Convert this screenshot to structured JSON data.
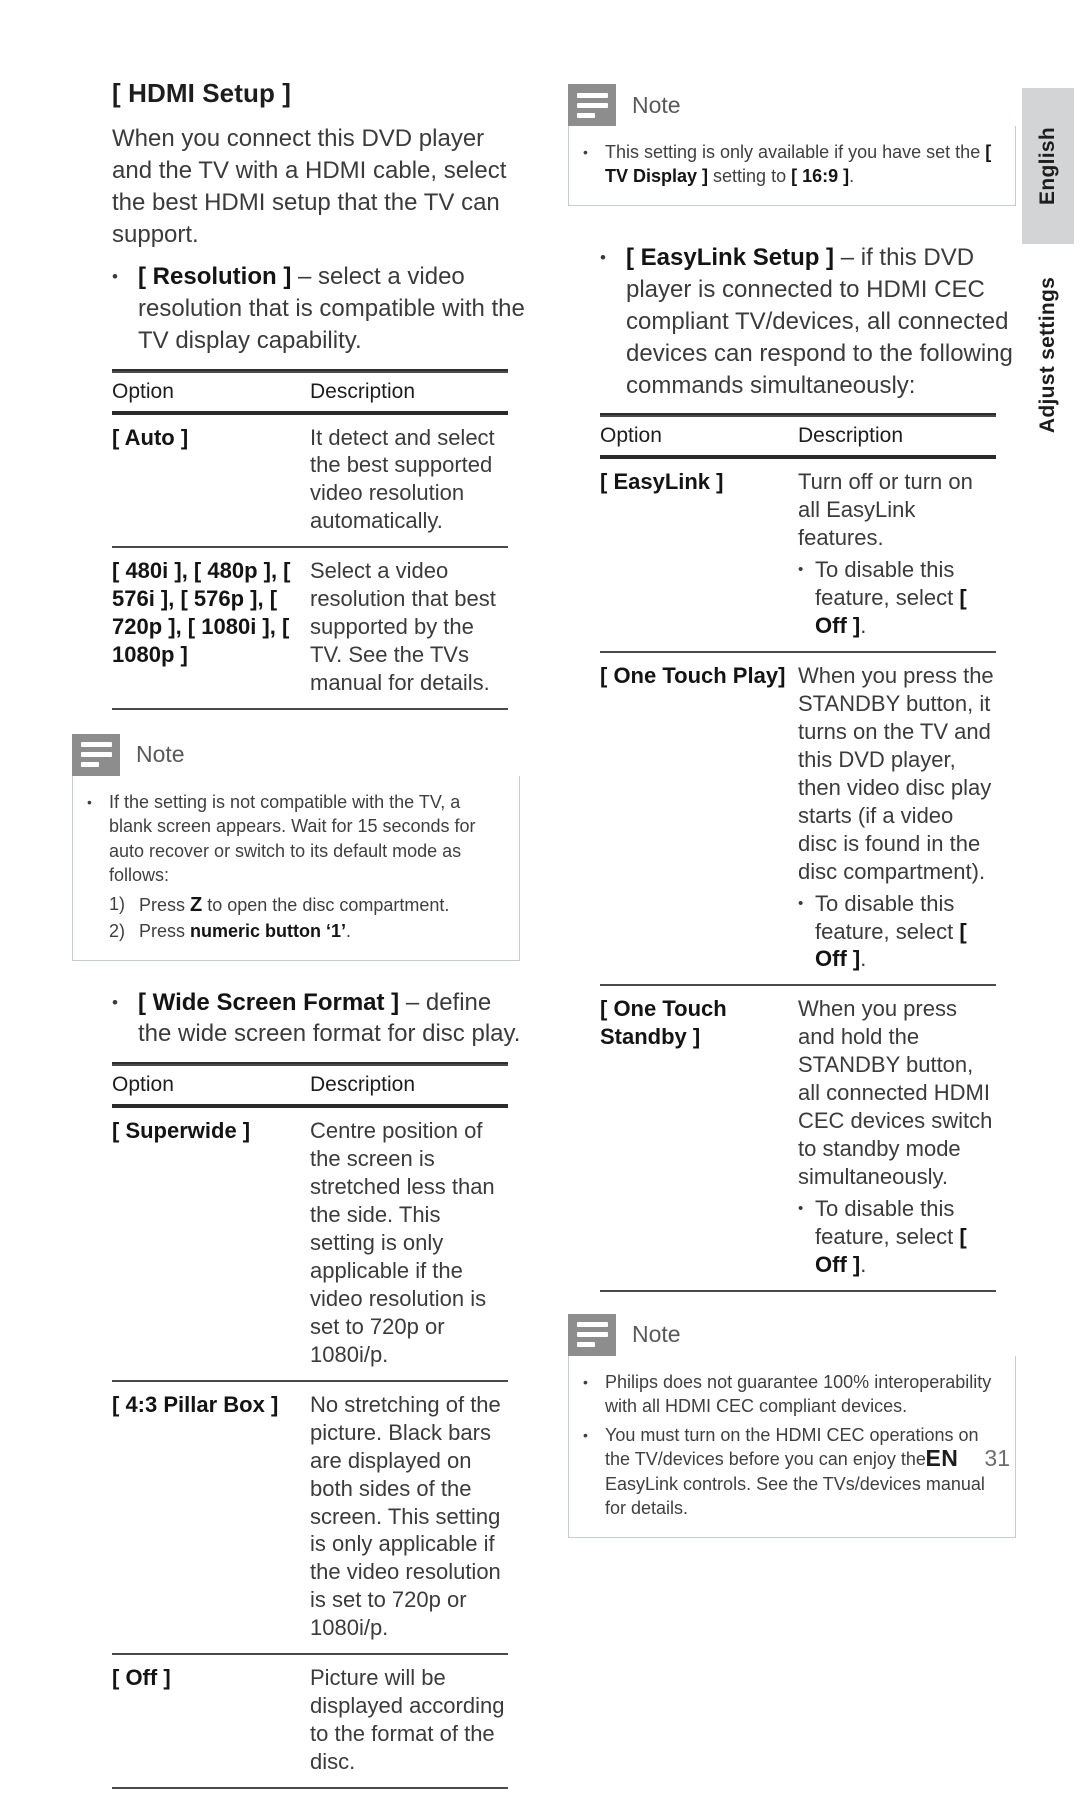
{
  "document": {
    "language_tab": "English",
    "section_tab": "Adjust settings",
    "footer_lang": "EN",
    "footer_page": "31"
  },
  "left_column": {
    "heading": "[ HDMI Setup ]",
    "intro": "When you connect this DVD player and the TV with a HDMI cable, select the best HDMI setup that the TV can support.",
    "resolution_bullet": {
      "bold": "[ Resolution ]",
      "rest": " – select a video resolution that is compatible with the TV display capability."
    },
    "resolution_table": {
      "col_option": "Option",
      "col_description": "Description",
      "rows": [
        {
          "option": "[ Auto ]",
          "description": "It detect and select the best supported video resolution automatically."
        },
        {
          "option": "[ 480i ], [ 480p ], [ 576i ], [ 576p ], [ 720p ], [ 1080i ], [ 1080p ]",
          "description": "Select a video resolution that best supported by the TV. See the TVs manual for details."
        }
      ]
    },
    "note": {
      "title": "Note",
      "bullet": "If the setting is not compatible with the TV, a blank screen appears.  Wait for 15 seconds for auto recover or switch to its default mode as follows:",
      "step1_num": "1)",
      "step1_pre": "Press ",
      "step1_glyph": "Z",
      "step1_post": " to open the disc compartment.",
      "step2_num": "2)",
      "step2_pre": "Press ",
      "step2_bold": "numeric button ‘1’",
      "step2_post": "."
    },
    "widescreen_bullet": {
      "bold": "[ Wide Screen Format ]",
      "rest": " – define the wide screen format for disc play."
    },
    "widescreen_table": {
      "col_option": "Option",
      "col_description": "Description",
      "rows": [
        {
          "option": "[ Superwide ]",
          "description": "Centre position of the screen is stretched less than the side. This setting is only applicable if the video resolution is set to 720p or 1080i/p."
        },
        {
          "option": "[ 4:3 Pillar Box ]",
          "description": "No stretching of the picture. Black bars are displayed on both sides of the screen. This setting is only applicable if the video resolution is set to 720p or 1080i/p."
        },
        {
          "option": "[ Off ]",
          "description": "Picture will be displayed according to the format of the disc."
        }
      ]
    }
  },
  "right_column": {
    "note_top": {
      "title": "Note",
      "pre": "This setting is only available if you have set the ",
      "bold1": "[ TV Display ]",
      "mid": " setting to ",
      "bold2": "[ 16:9 ]",
      "post": "."
    },
    "easylink_bullet": {
      "bold": "[ EasyLink Setup ]",
      "rest": " – if this DVD player is connected to HDMI CEC compliant TV/devices, all connected devices can respond to the following commands simultaneously:"
    },
    "easylink_table": {
      "col_option": "Option",
      "col_description": "Description",
      "rows": [
        {
          "option": "[ EasyLink ]",
          "description": "Turn off or turn on all EasyLink features.",
          "sub_pre": "To disable this feature, select ",
          "sub_bold": "[ Off ]",
          "sub_post": "."
        },
        {
          "option": "[ One Touch Play]",
          "description": "When you press the STANDBY button, it turns on the TV and this DVD player, then video disc play starts (if a video disc is found in the disc compartment).",
          "sub_pre": "To disable this feature, select ",
          "sub_bold": "[ Off ]",
          "sub_post": "."
        },
        {
          "option": "[ One Touch Standby ]",
          "description": "When you press and hold the STANDBY button, all connected HDMI CEC devices switch to standby mode simultaneously.",
          "sub_pre": "To disable this feature, select ",
          "sub_bold": "[ Off ]",
          "sub_post": "."
        }
      ]
    },
    "note_bottom": {
      "title": "Note",
      "bullet1": "Philips does not guarantee 100% interoperability with all HDMI CEC compliant devices.",
      "bullet2": "You must turn on the HDMI CEC operations on the TV/devices before you can enjoy the EasyLink controls. See the TVs/devices manual for details."
    }
  }
}
